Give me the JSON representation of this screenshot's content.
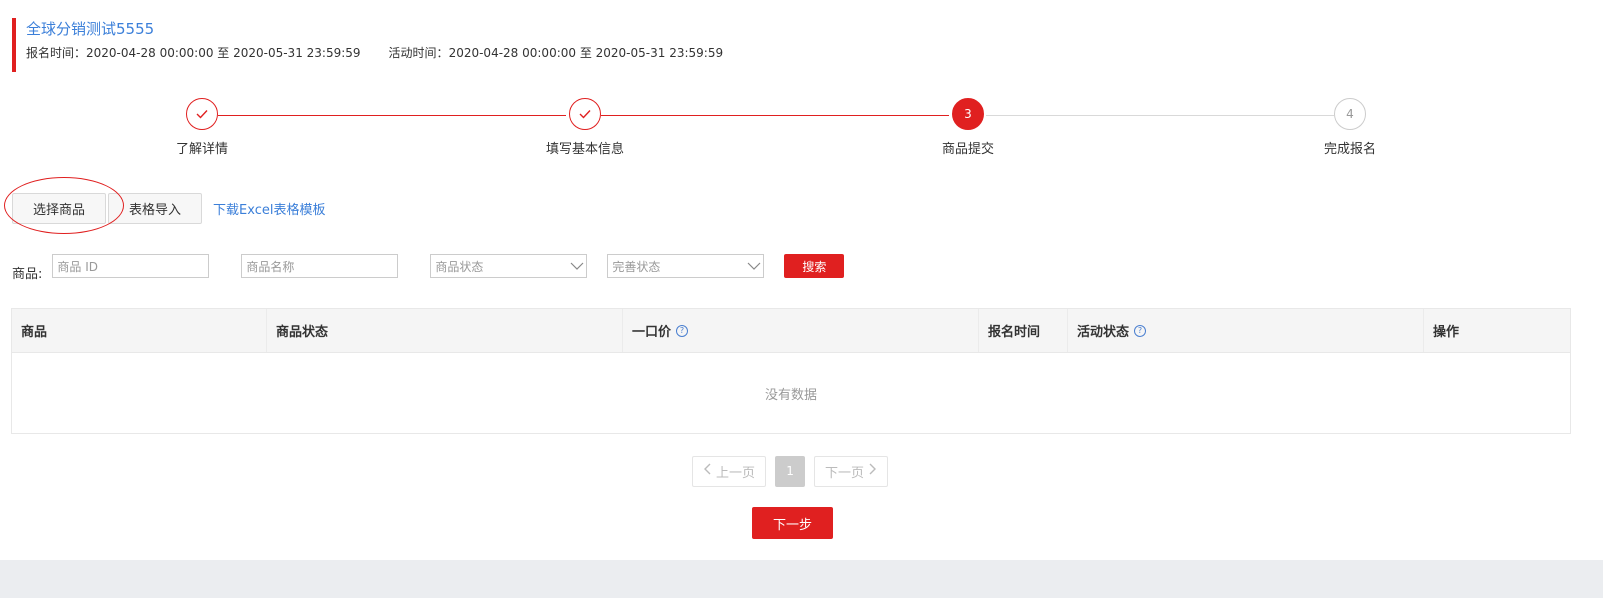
{
  "header": {
    "title": "全球分销测试5555",
    "signup_time_label": "报名时间：",
    "signup_time_value": "2020-04-28 00:00:00 至 2020-05-31 23:59:59",
    "activity_time_label": "活动时间：",
    "activity_time_value": "2020-04-28 00:00:00 至 2020-05-31 23:59:59"
  },
  "steps": [
    {
      "label": "了解详情",
      "state": "done",
      "num": "1"
    },
    {
      "label": "填写基本信息",
      "state": "done",
      "num": "2"
    },
    {
      "label": "商品提交",
      "state": "active",
      "num": "3"
    },
    {
      "label": "完成报名",
      "state": "todo",
      "num": "4"
    }
  ],
  "toolbar": {
    "select_goods": "选择商品",
    "import_table": "表格导入",
    "download_template": "下载Excel表格模板"
  },
  "filters": {
    "label": "商品:",
    "goods_id_placeholder": "商品 ID",
    "goods_name_placeholder": "商品名称",
    "goods_status": "商品状态",
    "complete_status": "完善状态",
    "search": "搜索"
  },
  "table": {
    "columns": [
      "商品",
      "商品状态",
      "一口价",
      "报名时间",
      "活动状态",
      "操作"
    ],
    "empty_text": "没有数据"
  },
  "pagination": {
    "prev": "上一页",
    "page": "1",
    "next": "下一页"
  },
  "next_step": "下一步",
  "colors": {
    "accent": "#e02020",
    "link": "#3b7fd9"
  }
}
